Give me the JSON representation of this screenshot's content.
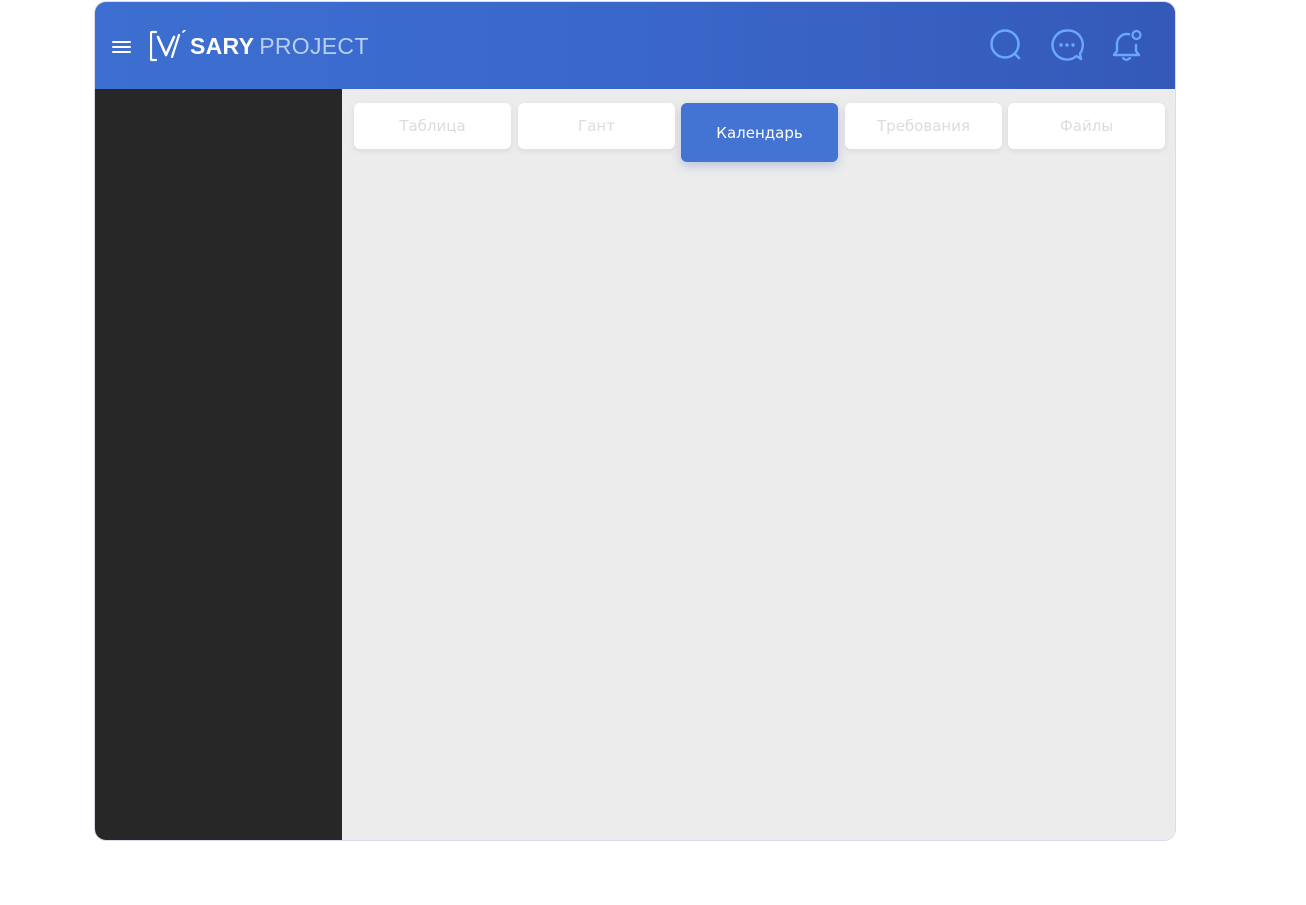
{
  "header": {
    "logo": {
      "brand": "SARY",
      "product": "PROJECT"
    }
  },
  "tabs": [
    {
      "label": "Таблица",
      "active": false
    },
    {
      "label": "Гант",
      "active": false
    },
    {
      "label": "Календарь",
      "active": true
    },
    {
      "label": "Требования",
      "active": false
    },
    {
      "label": "Файлы",
      "active": false
    }
  ],
  "colors": {
    "header_gradient_start": "#3c6fd1",
    "header_gradient_end": "#3459b8",
    "icon_accent": "#6aa8ff",
    "sidebar_bg": "#272727",
    "content_bg": "#ececec",
    "active_tab": "#4373d3"
  },
  "icons": [
    "menu-icon",
    "search-icon",
    "chat-icon",
    "bell-icon"
  ]
}
